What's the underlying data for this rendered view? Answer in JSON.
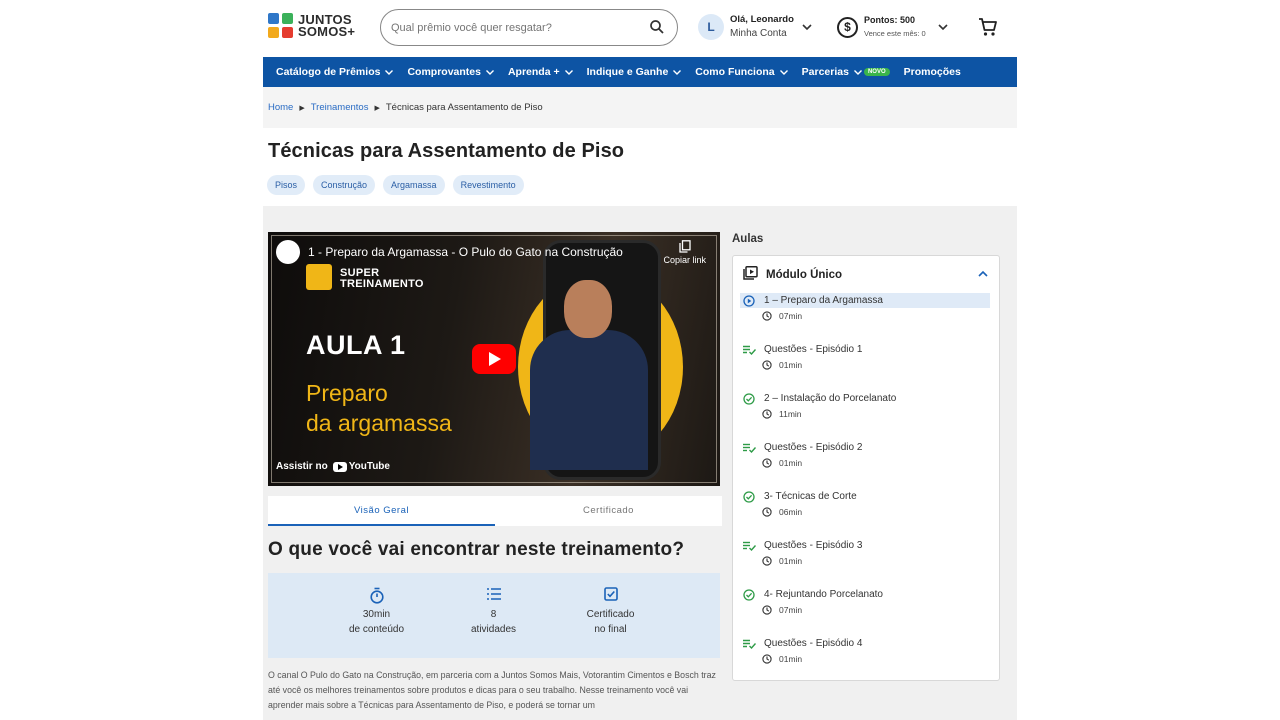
{
  "header": {
    "logo_line1": "JUNTOS",
    "logo_line2": "SOMOS+",
    "search_placeholder": "Qual prêmio você quer resgatar?",
    "avatar_initial": "L",
    "greeting": "Olá, Leonardo",
    "account_label": "Minha Conta",
    "points_label": "Pontos: 500",
    "points_expiry": "Vence este mês: 0",
    "coin_symbol": "$"
  },
  "nav": {
    "items": [
      {
        "label": "Catálogo de Prêmios",
        "dropdown": true
      },
      {
        "label": "Comprovantes",
        "dropdown": true
      },
      {
        "label": "Aprenda +",
        "dropdown": true
      },
      {
        "label": "Indique e Ganhe",
        "dropdown": true
      },
      {
        "label": "Como Funciona",
        "dropdown": true
      },
      {
        "label": "Parcerias",
        "dropdown": true
      },
      {
        "label": "Promoções",
        "dropdown": false
      }
    ],
    "new_badge": "NOVO"
  },
  "breadcrumb": {
    "items": [
      "Home",
      "Treinamentos"
    ],
    "current": "Técnicas para Assentamento de Piso"
  },
  "page": {
    "title": "Técnicas para Assentamento de Piso",
    "tags": [
      "Pisos",
      "Construção",
      "Argamassa",
      "Revestimento"
    ]
  },
  "video": {
    "title": "1 - Preparo da Argamassa - O Pulo do Gato na Construção",
    "channel_label": "JUNTOS SOMOS+",
    "copy_link": "Copiar link",
    "brand_line1": "SUPER",
    "brand_line2": "TREINAMENTO",
    "lesson_heading": "AULA 1",
    "lesson_sub1": "Preparo",
    "lesson_sub2": "da argamassa",
    "watch_on": "Assistir no",
    "youtube": "YouTube"
  },
  "tabs": {
    "items": [
      "Visão Geral",
      "Certificado"
    ],
    "active": 0
  },
  "overview": {
    "heading": "O que você vai encontrar neste treinamento?",
    "stats": [
      {
        "icon": "stopwatch-icon",
        "line1": "30min",
        "line2": "de conteúdo"
      },
      {
        "icon": "list-icon",
        "line1": "8",
        "line2": "atividades"
      },
      {
        "icon": "checkbox-icon",
        "line1": "Certificado",
        "line2": "no final"
      }
    ],
    "description": "O canal O Pulo do Gato na Construção, em parceria com a Juntos Somos Mais, Votorantim Cimentos e Bosch traz até você os melhores treinamentos sobre produtos e dicas para o seu trabalho. Nesse treinamento você vai aprender mais sobre a Técnicas para Assentamento de Piso, e poderá se tornar um"
  },
  "sidebar": {
    "label": "Aulas",
    "module_title": "Módulo Único",
    "lessons": [
      {
        "title": "1 – Preparo da Argamassa",
        "duration": "07min",
        "status": "playing"
      },
      {
        "title": "Questões - Episódio 1",
        "duration": "01min",
        "status": "quiz"
      },
      {
        "title": "2 – Instalação do Porcelanato",
        "duration": "11min",
        "status": "done"
      },
      {
        "title": "Questões - Episódio 2",
        "duration": "01min",
        "status": "quiz"
      },
      {
        "title": "3- Técnicas de Corte",
        "duration": "06min",
        "status": "done"
      },
      {
        "title": "Questões - Episódio 3",
        "duration": "01min",
        "status": "quiz"
      },
      {
        "title": "4- Rejuntando Porcelanato",
        "duration": "07min",
        "status": "done"
      },
      {
        "title": "Questões - Episódio 4",
        "duration": "01min",
        "status": "quiz"
      }
    ]
  },
  "colors": {
    "nav_bg": "#0d54a4",
    "accent": "#1a62b8",
    "done_green": "#2e9b47",
    "badge_green": "#3ab54a",
    "video_yellow": "#f0b617"
  }
}
